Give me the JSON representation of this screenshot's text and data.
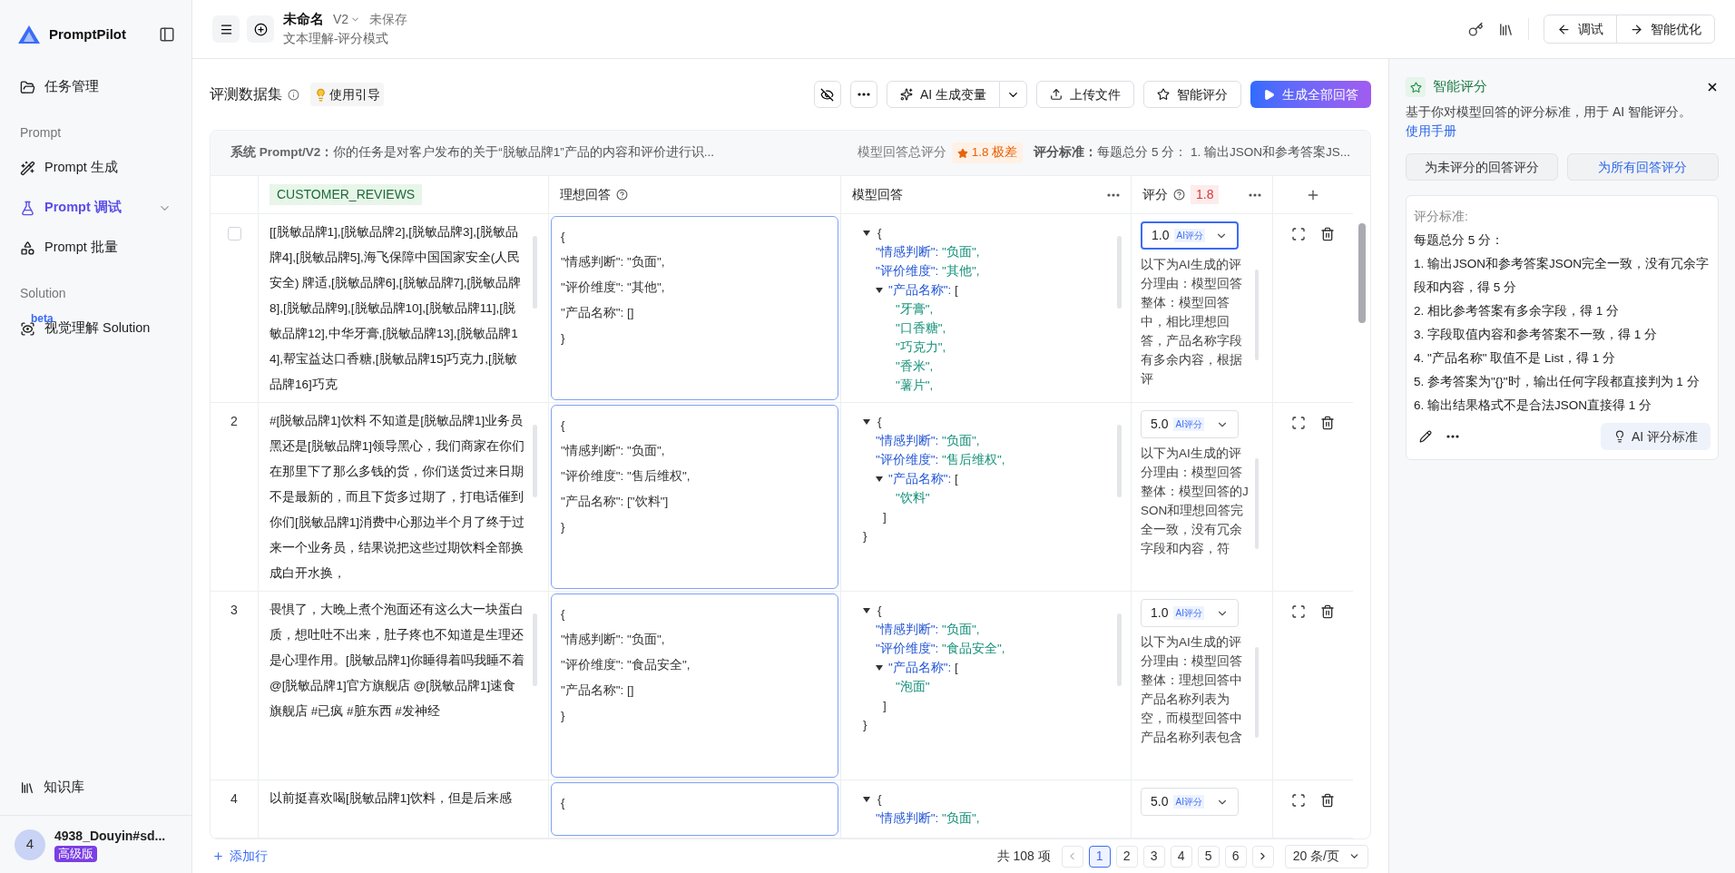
{
  "sidebar": {
    "brand": "PromptPilot",
    "items": [
      {
        "kind": "item",
        "label": "任务管理",
        "selected": false,
        "expandable": false
      },
      {
        "kind": "section",
        "label": "Prompt"
      },
      {
        "kind": "item",
        "label": "Prompt 生成",
        "selected": false,
        "expandable": false
      },
      {
        "kind": "item",
        "label": "Prompt 调试",
        "selected": true,
        "expandable": true
      },
      {
        "kind": "item",
        "label": "Prompt 批量",
        "selected": false,
        "expandable": false
      },
      {
        "kind": "section",
        "label": "Solution"
      },
      {
        "kind": "item",
        "label": "视觉理解 Solution",
        "selected": false,
        "expandable": false,
        "badge": "beta"
      }
    ],
    "bottom_item": "知识库",
    "user": {
      "avatar": "4",
      "name": "4938_Douyin#sd...",
      "plan": "高级版"
    }
  },
  "header": {
    "title": "未命名",
    "version": "V2",
    "save_status": "未保存",
    "subtitle": "文本理解-评分模式",
    "modes": [
      "调试",
      "智能优化"
    ]
  },
  "toolbar": {
    "title": "评测数据集",
    "guide": "使用引导",
    "buttons": [
      {
        "kind": "ai",
        "label": "AI 生成变量"
      },
      {
        "kind": "upload",
        "label": "上传文件"
      },
      {
        "kind": "score",
        "label": "智能评分"
      },
      {
        "kind": "primary",
        "label": "生成全部回答"
      }
    ]
  },
  "summary": {
    "prompt_label": "系统 Prompt/V2：",
    "prompt_text": "你的任务是对客户发布的关于“脱敏品牌1”产品的内容和评价进行识...",
    "score_label": "模型回答总评分",
    "score": "1.8 极差",
    "criteria_label": "评分标准：",
    "criteria_text": "每题总分 5 分： 1. 输出JSON和参考答案JS..."
  },
  "table": {
    "columns": [
      {
        "kind": "variable",
        "label": "CUSTOMER_REVIEWS"
      },
      {
        "kind": "ideal",
        "label": "理想回答"
      },
      {
        "kind": "model",
        "label": "模型回答"
      },
      {
        "kind": "score",
        "label": "评分",
        "average": "1.8"
      }
    ],
    "rows": [
      {
        "kind": "checkbox",
        "checked": false,
        "review": "[[脱敏品牌1],[脱敏品牌2],[脱敏品牌3],[脱敏品牌4],[脱敏品牌5],海飞保障中国国家安全(人民安全) 牌适,[脱敏品牌6],[脱敏品牌7],[脱敏品牌8],[脱敏品牌9],[脱敏品牌10],[脱敏品牌11],[脱敏品牌12],中华牙膏,[脱敏品牌13],[脱敏品牌14],帮宝益达口香糖,[脱敏品牌15]巧克力,[脱敏品牌16]巧克",
        "ideal": [
          "{",
          "\"情感判断\": \"负面\",",
          "\"评价维度\": \"其他\",",
          "\"产品名称\": []",
          "}"
        ],
        "model": {
          "expanded": true,
          "open": "{",
          "fields": [
            {
              "key": "\"情感判断\":",
              "value": "\"负面\","
            },
            {
              "key": "\"评价维度\":",
              "value": "\"其他\","
            }
          ],
          "list": {
            "key": "\"产品名称\":",
            "bracket": "[",
            "expanded": true,
            "items": [
              "\"牙膏\",",
              "\"口香糖\",",
              "\"巧克力\",",
              "\"香米\",",
              "\"薯片\","
            ]
          }
        },
        "score": {
          "value": "1.0",
          "badge": "AI评分",
          "focused": true,
          "reason": "以下为AI生成的评分理由：模型回答整体：模型回答中，相比理想回答，产品名称字段有多余内容，根据评"
        }
      },
      {
        "kind": "number",
        "number": "2",
        "review": "#[脱敏品牌1]饮料 不知道是[脱敏品牌1]业务员黑还是[脱敏品牌1]领导黑心，我们商家在你们在那里下了那么多钱的货，你们送货过来日期不是最新的，而且下货多过期了，打电话催到你们[脱敏品牌1]消费中心那边半个月了终于过来一个业务员，结果说把这些过期饮料全部换成白开水换，",
        "ideal": [
          "{",
          "\"情感判断\": \"负面\",",
          "\"评价维度\": \"售后维权\",",
          "\"产品名称\": [\"饮料\"]",
          "}"
        ],
        "model": {
          "expanded": true,
          "open": "{",
          "fields": [
            {
              "key": "\"情感判断\":",
              "value": "\"负面\","
            },
            {
              "key": "\"评价维度\":",
              "value": "\"售后维权\","
            }
          ],
          "list": {
            "key": "\"产品名称\":",
            "bracket": "[",
            "expanded": true,
            "items": [
              "\"饮料\""
            ],
            "close": "]"
          },
          "close": "}"
        },
        "score": {
          "value": "5.0",
          "badge": "AI评分",
          "focused": false,
          "reason": "以下为AI生成的评分理由：模型回答整体：模型回答的JSON和理想回答完全一致，没有冗余字段和内容，符"
        }
      },
      {
        "kind": "number",
        "number": "3",
        "review": "畏惧了，大晚上煮个泡面还有这么大一块蛋白质，想吐吐不出来，肚子疼也不知道是生理还是心理作用。[脱敏品牌1]你睡得着吗我睡不着 @[脱敏品牌1]官方旗舰店 @[脱敏品牌1]速食旗舰店 #已疯 #脏东西 #发神经",
        "ideal": [
          "{",
          "\"情感判断\": \"负面\",",
          "\"评价维度\": \"食品安全\",",
          "\"产品名称\": []",
          "}"
        ],
        "model": {
          "expanded": true,
          "open": "{",
          "fields": [
            {
              "key": "\"情感判断\":",
              "value": "\"负面\","
            },
            {
              "key": "\"评价维度\":",
              "value": "\"食品安全\","
            }
          ],
          "list": {
            "key": "\"产品名称\":",
            "bracket": "[",
            "expanded": true,
            "items": [
              "\"泡面\""
            ],
            "close": "]"
          },
          "close": "}"
        },
        "score": {
          "value": "1.0",
          "badge": "AI评分",
          "focused": false,
          "reason": "以下为AI生成的评分理由：模型回答整体：理想回答中产品名称列表为空，而模型回答中产品名称列表包含"
        }
      },
      {
        "kind": "number",
        "number": "4",
        "review": "以前挺喜欢喝[脱敏品牌1]饮料，但是后来感",
        "ideal": [
          "{"
        ],
        "model": {
          "expanded": true,
          "open": "{",
          "fields": [
            {
              "key": "\"情感判断\":",
              "value": "\"负面\","
            }
          ]
        },
        "score": {
          "value": "5.0",
          "badge": "AI评分",
          "focused": false
        }
      }
    ]
  },
  "footer": {
    "add_row": "添加行",
    "total": "共 108 项",
    "pages": [
      {
        "label": "1",
        "selected": true
      },
      {
        "label": "2",
        "selected": false
      },
      {
        "label": "3",
        "selected": false
      },
      {
        "label": "4",
        "selected": false
      },
      {
        "label": "5",
        "selected": false
      },
      {
        "label": "6",
        "selected": false
      }
    ],
    "page_size": "20 条/页"
  },
  "panel": {
    "title": "智能评分",
    "description": "基于你对模型回答的评分标准，用于 AI 智能评分。",
    "manual_link": "使用手册",
    "buttons": [
      {
        "kind": "default",
        "label": "为未评分的回答评分"
      },
      {
        "kind": "accent",
        "label": "为所有回答评分"
      }
    ],
    "criteria_label": "评分标准:",
    "criteria": [
      "每题总分 5 分：",
      "1. 输出JSON和参考答案JSON完全一致，没有冗余字段和内容，得 5 分",
      "2. 相比参考答案有多余字段，得 1 分",
      "3. 字段取值内容和参考答案不一致，得 1 分",
      "4. \"产品名称\" 取值不是 List，得 1 分",
      "5. 参考答案为\"{}\"时，输出任何字段都直接判为 1 分",
      "6. 输出结果格式不是合法JSON直接得 1 分"
    ],
    "ai_button": "AI 评分标准"
  }
}
